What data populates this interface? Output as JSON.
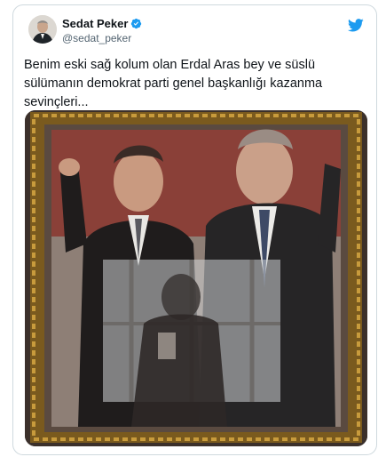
{
  "tweet": {
    "author": {
      "display_name": "Sedat Peker",
      "handle": "@sedat_peker",
      "verified": true
    },
    "text": "Benim eski sağ kolum olan Erdal Aras bey ve süslü sülümanın demokrat parti genel başkanlığı kazanma sevinçleri...",
    "platform_icon": "twitter-bird-icon",
    "colors": {
      "brand": "#1d9bf0",
      "text": "#0f1419",
      "secondary_text": "#536471",
      "border": "#cfd9de"
    }
  }
}
